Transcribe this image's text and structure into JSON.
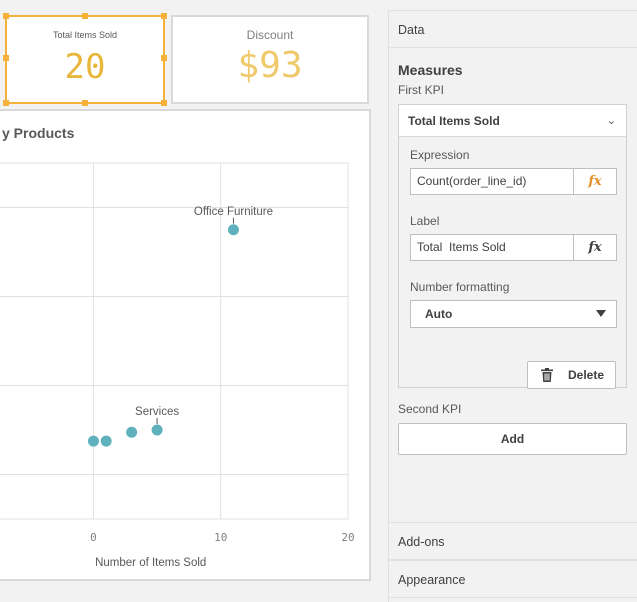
{
  "kpi_objects": [
    {
      "title": "Total Items Sold",
      "value": "20"
    },
    {
      "title": "Discount",
      "value": "$93"
    }
  ],
  "chart_data": {
    "type": "scatter",
    "title": "y Products",
    "xlabel": "Number of Items Sold",
    "ylabel": "",
    "xlim": [
      -7.5,
      20
    ],
    "ylim": [
      -2,
      14
    ],
    "grid": true,
    "x_ticks": [
      "0",
      "10",
      "20"
    ],
    "points": [
      {
        "x": 11,
        "y": 11,
        "label": "Office Furniture"
      },
      {
        "x": 5,
        "y": 2,
        "label": "Services"
      },
      {
        "x": 3,
        "y": 1.9,
        "label": ""
      },
      {
        "x": 1,
        "y": 1.5,
        "label": ""
      },
      {
        "x": 0,
        "y": 1.5,
        "label": ""
      }
    ],
    "point_color": "#5fb2bd"
  },
  "panel": {
    "data_section": "Data",
    "measures_title": "Measures",
    "first_kpi_label": "First KPI",
    "kpi_card": {
      "title": "Total Items Sold",
      "expression_label": "Expression",
      "expression_value": "Count(order_line_id)",
      "label_label": "Label",
      "label_value": "Total  Items Sold",
      "fx_glyph": "fx",
      "number_formatting_label": "Number formatting",
      "number_formatting_value": "Auto",
      "delete_label": "Delete"
    },
    "second_kpi_label": "Second KPI",
    "add_label": "Add",
    "addons_section": "Add-ons",
    "appearance_section": "Appearance"
  },
  "colors": {
    "selection": "#f5b13a",
    "kpi1_value": "#e8b63a",
    "kpi2_value": "#efc96a",
    "fx_accent": "#e8902a"
  }
}
